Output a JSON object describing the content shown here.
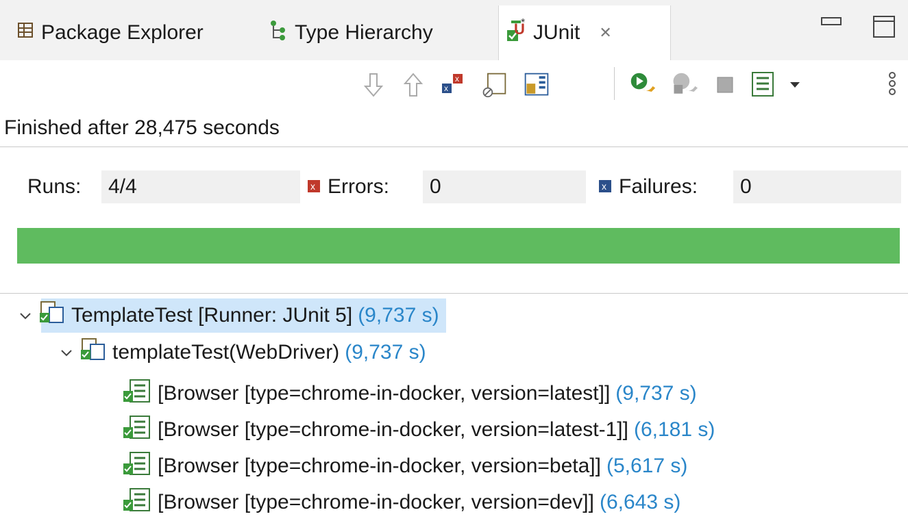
{
  "tabs": [
    {
      "label": "Package Explorer",
      "icon": "package-explorer-icon"
    },
    {
      "label": "Type Hierarchy",
      "icon": "type-hierarchy-icon"
    },
    {
      "label": "JUnit",
      "icon": "junit-icon",
      "active": true,
      "close": "✕"
    }
  ],
  "toolbar": {
    "icons": [
      "next-failure-icon",
      "previous-failure-icon",
      "show-failures-only-icon",
      "show-skipped-only-icon",
      "scroll-lock-icon",
      "rerun-test-icon",
      "rerun-failed-first-icon",
      "stop-icon",
      "test-run-history-icon",
      "view-menu-icon",
      "more-options-icon"
    ]
  },
  "status": {
    "text": "Finished after 28,475 seconds"
  },
  "counters": {
    "runs_label": "Runs:",
    "runs_value": "4/4",
    "errors_label": "Errors:",
    "errors_value": "0",
    "failures_label": "Failures:",
    "failures_value": "0"
  },
  "progress": {
    "fraction": 1.0,
    "color": "#5fbb5f"
  },
  "tree": {
    "root": {
      "label": "TemplateTest [Runner: JUnit 5]",
      "time": "(9,737 s)"
    },
    "method": {
      "label": "templateTest(WebDriver)",
      "time": "(9,737 s)"
    },
    "cases": [
      {
        "label": "[Browser [type=chrome-in-docker, version=latest]]",
        "time": "(9,737 s)"
      },
      {
        "label": "[Browser [type=chrome-in-docker, version=latest-1]]",
        "time": "(6,181 s)"
      },
      {
        "label": "[Browser [type=chrome-in-docker, version=beta]]",
        "time": "(5,617 s)"
      },
      {
        "label": "[Browser [type=chrome-in-docker, version=dev]]",
        "time": "(6,643 s)"
      }
    ]
  },
  "colors": {
    "time": "#2a86c9",
    "selection": "#cfe6fa",
    "success": "#5fbb5f"
  }
}
